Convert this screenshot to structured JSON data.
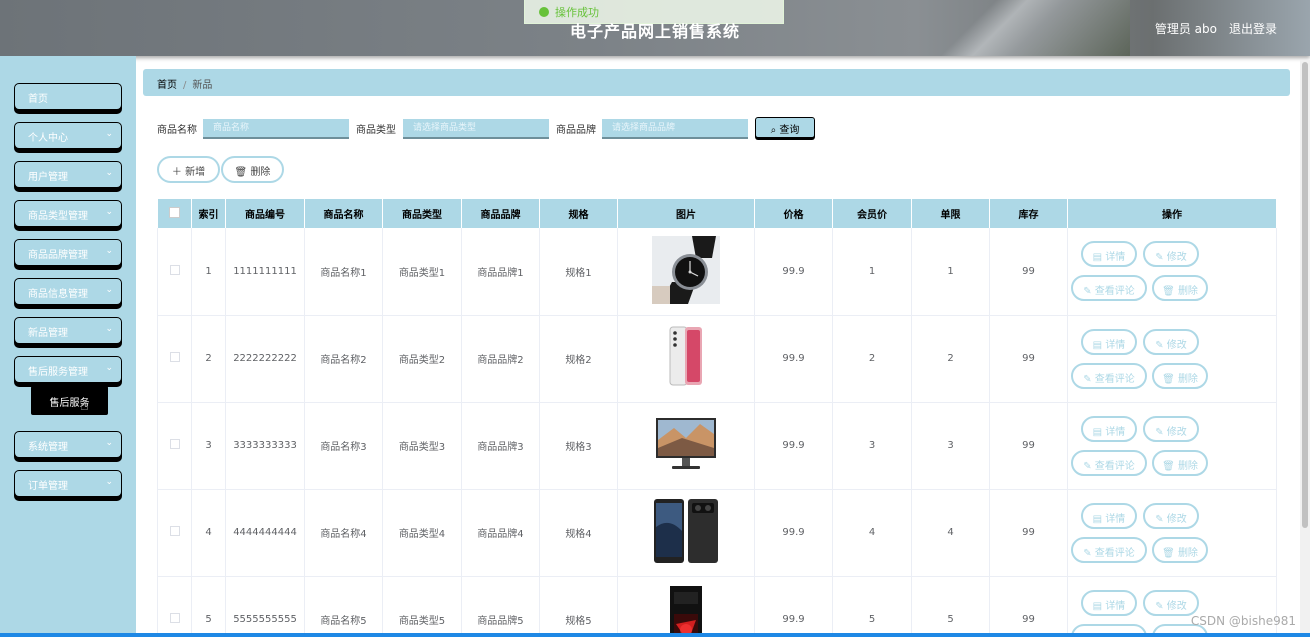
{
  "header": {
    "title": "电子产品网上销售系统",
    "toast": "操作成功",
    "user": "管理员 abo",
    "logout": "退出登录"
  },
  "sidebar": {
    "items": [
      {
        "label": "首页",
        "chevron": false
      },
      {
        "label": "个人中心",
        "chevron": true
      },
      {
        "label": "用户管理",
        "chevron": true
      },
      {
        "label": "商品类型管理",
        "chevron": true
      },
      {
        "label": "商品品牌管理",
        "chevron": true
      },
      {
        "label": "商品信息管理",
        "chevron": true
      },
      {
        "label": "新品管理",
        "chevron": true
      },
      {
        "label": "售后服务管理",
        "chevron": true
      },
      {
        "label": "系统管理",
        "chevron": true
      },
      {
        "label": "订单管理",
        "chevron": true
      }
    ],
    "submenu_label": "售后服务"
  },
  "breadcrumb": {
    "home": "首页",
    "current": "新品"
  },
  "search": {
    "name_label": "商品名称",
    "name_placeholder": "商品名称",
    "type_label": "商品类型",
    "type_placeholder": "请选择商品类型",
    "brand_label": "商品品牌",
    "brand_placeholder": "请选择商品品牌",
    "query_label": "查询"
  },
  "actions": {
    "add_label": "新增",
    "delete_label": "删除"
  },
  "table": {
    "headers": [
      "索引",
      "商品编号",
      "商品名称",
      "商品类型",
      "商品品牌",
      "规格",
      "图片",
      "价格",
      "会员价",
      "单限",
      "库存",
      "操作"
    ],
    "rows": [
      {
        "index": "1",
        "code": "1111111111",
        "name": "商品名称1",
        "type": "商品类型1",
        "brand": "商品品牌1",
        "spec": "规格1",
        "image": "watch",
        "price": "99.9",
        "member_price": "1",
        "limit": "1",
        "stock": "99"
      },
      {
        "index": "2",
        "code": "2222222222",
        "name": "商品名称2",
        "type": "商品类型2",
        "brand": "商品品牌2",
        "spec": "规格2",
        "image": "phone-white",
        "price": "99.9",
        "member_price": "2",
        "limit": "2",
        "stock": "99"
      },
      {
        "index": "3",
        "code": "3333333333",
        "name": "商品名称3",
        "type": "商品类型3",
        "brand": "商品品牌3",
        "spec": "规格3",
        "image": "monitor",
        "price": "99.9",
        "member_price": "3",
        "limit": "3",
        "stock": "99"
      },
      {
        "index": "4",
        "code": "4444444444",
        "name": "商品名称4",
        "type": "商品类型4",
        "brand": "商品品牌4",
        "spec": "规格4",
        "image": "phone-dark",
        "price": "99.9",
        "member_price": "4",
        "limit": "4",
        "stock": "99"
      },
      {
        "index": "5",
        "code": "5555555555",
        "name": "商品名称5",
        "type": "商品类型5",
        "brand": "商品品牌5",
        "spec": "规格5",
        "image": "pc-case",
        "price": "99.9",
        "member_price": "5",
        "limit": "5",
        "stock": "99"
      }
    ],
    "row_ops": {
      "detail": "详情",
      "edit": "修改",
      "reviews": "查看评论",
      "delete": "删除"
    }
  },
  "watermark": "CSDN @bishe981",
  "colors": {
    "accent": "#add8e6",
    "border": "#000000",
    "header_text": "#ffffff"
  }
}
